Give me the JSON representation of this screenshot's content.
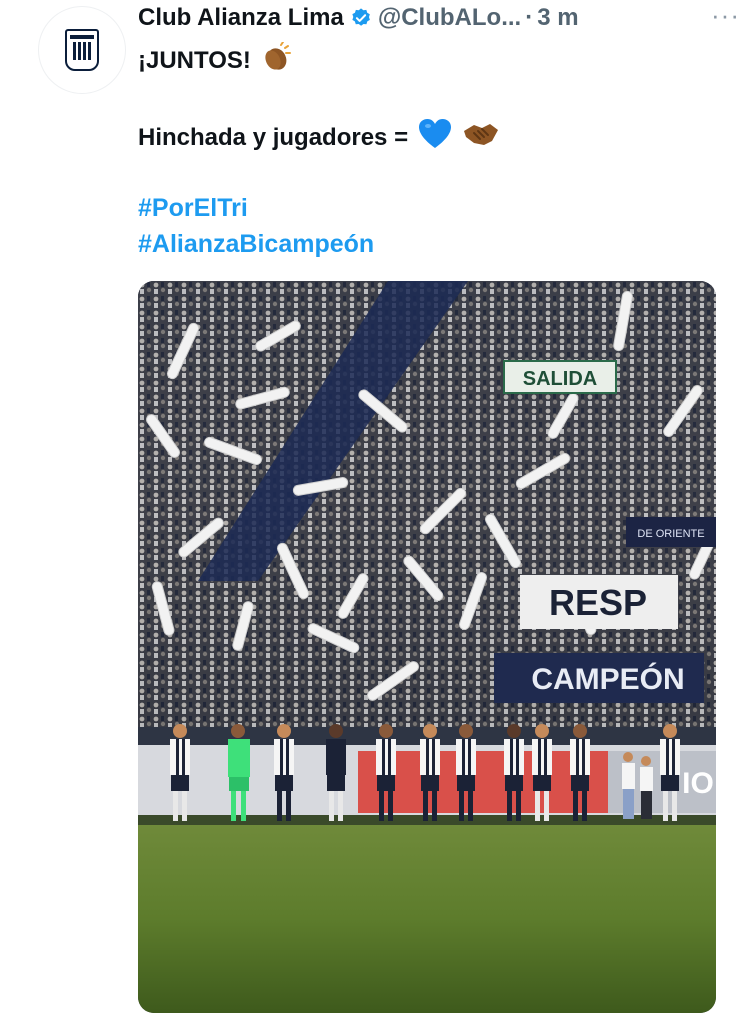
{
  "tweet": {
    "author_name": "Club Alianza Lima",
    "handle": "@ClubALo...",
    "separator": "·",
    "time": "3 m",
    "more": "···",
    "lines": [
      "¡JUNTOS!",
      "Hinchada y jugadores ="
    ],
    "hashtags": [
      "#PorElTri",
      "#AlianzaBicampeón"
    ],
    "icons": {
      "avatar": "alianza-lima-crest",
      "verified": "verified-badge-icon",
      "clap": "clapping-hands-emoji",
      "heart": "blue-heart-emoji",
      "handshake": "handshake-emoji"
    }
  },
  "media": {
    "signs": {
      "exit": "SALIDA",
      "banner_left": "RESP",
      "banner_right": "CAMPEÓN",
      "flag_small": "DE ORIENTE",
      "pitch_board": "IO"
    }
  },
  "colors": {
    "link": "#1d9bf0",
    "verified": "#1d9bf0",
    "text": "#0f1419",
    "muted": "#536471"
  }
}
